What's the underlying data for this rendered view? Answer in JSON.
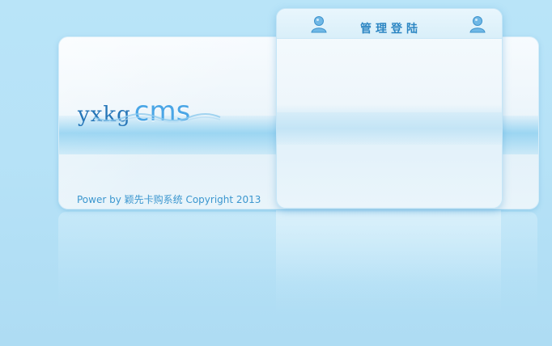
{
  "logo": {
    "text_main": "yxkg",
    "text_accent": "cms"
  },
  "login_panel": {
    "title": "管理登陆",
    "icons": [
      "user-icon",
      "user-icon"
    ]
  },
  "footer": {
    "copyright": "Power by 颖先卡购系统 Copyright 2013"
  },
  "colors": {
    "background": "#b9e4f8",
    "accent": "#2c86c3",
    "logo_blue": "#2676b8",
    "footer_text": "#3b96cf"
  }
}
